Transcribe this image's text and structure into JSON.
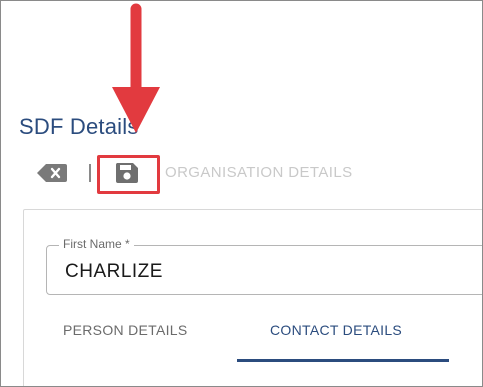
{
  "page": {
    "title": "SDF Details"
  },
  "toolbar": {
    "back_icon": "backspace-icon",
    "save_icon": "save-icon",
    "org_details_label": "ORGANISATION DETAILS"
  },
  "form": {
    "first_name": {
      "label": "First Name *",
      "value": "CHARLIZE"
    }
  },
  "tabs": [
    {
      "label": "PERSON DETAILS",
      "active": false
    },
    {
      "label": "CONTACT DETAILS",
      "active": true
    }
  ],
  "annotation": {
    "arrow_icon": "arrow-down-icon",
    "highlight_color": "#e23a3f"
  },
  "colors": {
    "accent": "#2b4c7e",
    "disabled_text": "#c9c9c9",
    "annotation_red": "#e23a3f"
  }
}
